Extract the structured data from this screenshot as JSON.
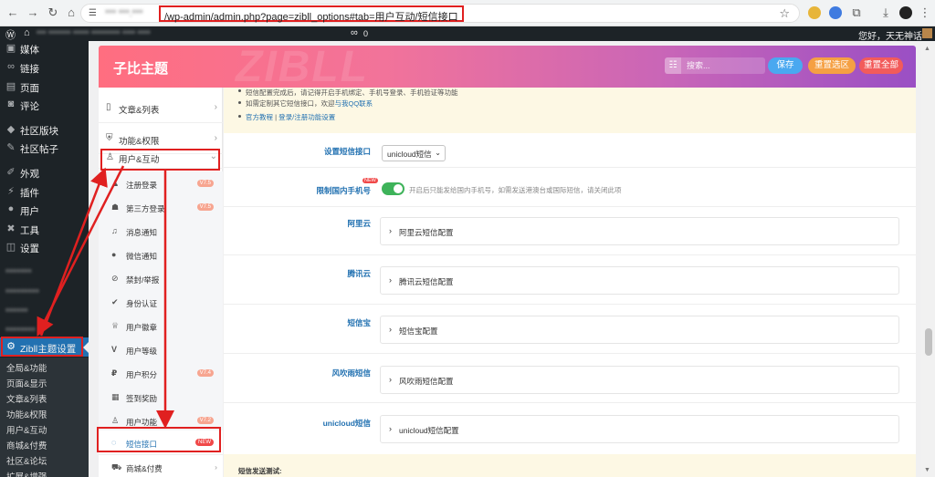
{
  "browser": {
    "url_site": "*** ***.***",
    "url_path": "/wp-admin/admin.php?page=zibll_options#tab=用户互动/短信接口",
    "icons": [
      "back-icon",
      "forward-icon",
      "reload-icon",
      "home-icon",
      "star-icon",
      "download-icon",
      "menu-icon"
    ]
  },
  "adminbar": {
    "blurred_items": "*** ******* ***** ********* **** ****",
    "comment_count": "0",
    "greeting": "您好，天无神话"
  },
  "wpmenu": {
    "items": [
      {
        "label": "媒体",
        "icon": "media-icon"
      },
      {
        "label": "链接",
        "icon": "link-icon"
      },
      {
        "label": "页面",
        "icon": "page-icon"
      },
      {
        "label": "评论",
        "icon": "comment-icon"
      },
      {
        "label": "社区版块",
        "icon": "forum-icon"
      },
      {
        "label": "社区帖子",
        "icon": "forum-post-icon"
      },
      {
        "label": "外观",
        "icon": "appearance-icon"
      },
      {
        "label": "插件",
        "icon": "plugin-icon"
      },
      {
        "label": "用户",
        "icon": "user-icon"
      },
      {
        "label": "工具",
        "icon": "tool-icon"
      },
      {
        "label": "设置",
        "icon": "settings-icon"
      }
    ],
    "blurred": [
      "*******",
      "*********",
      "******",
      "********"
    ],
    "active": "Zibll主题设置",
    "submenu": [
      "全局&功能",
      "页面&显示",
      "文章&列表",
      "功能&权限",
      "用户&互动",
      "商城&付费",
      "社区&论坛",
      "扩展&增强"
    ]
  },
  "header": {
    "title": "子比主题",
    "watermark": "ZIBLL",
    "search_placeholder": "搜索...",
    "save": "保存",
    "reset_section": "重置选区",
    "reset_all": "重置全部"
  },
  "optnav": {
    "groups": [
      {
        "label": "文章&列表",
        "icon": "book-icon"
      },
      {
        "label": "功能&权限",
        "icon": "shield-icon"
      },
      {
        "label": "用户&互动",
        "icon": "user-icon"
      }
    ],
    "subitems": [
      {
        "label": "注册登录",
        "icon": "user-plus-icon",
        "badge": "V7.5"
      },
      {
        "label": "第三方登录",
        "icon": "users-icon",
        "badge": "V7.5"
      },
      {
        "label": "消息通知",
        "icon": "bell-icon",
        "badge": ""
      },
      {
        "label": "微信通知",
        "icon": "wechat-icon",
        "badge": ""
      },
      {
        "label": "禁封/举报",
        "icon": "ban-icon",
        "badge": ""
      },
      {
        "label": "身份认证",
        "icon": "check-circle-icon",
        "badge": ""
      },
      {
        "label": "用户徽章",
        "icon": "trophy-icon",
        "badge": ""
      },
      {
        "label": "用户等级",
        "icon": "vip-icon",
        "badge": ""
      },
      {
        "label": "用户积分",
        "icon": "points-icon",
        "badge": "V7.4"
      },
      {
        "label": "签到奖励",
        "icon": "calendar-icon",
        "badge": ""
      },
      {
        "label": "用户功能",
        "icon": "user-icon",
        "badge": "V7.2"
      },
      {
        "label": "短信接口",
        "icon": "sms-icon",
        "badge": "NEW"
      }
    ],
    "shop": {
      "label": "商城&付费",
      "icon": "shop-icon"
    }
  },
  "notice": {
    "line1": "短信配置完成后，请记得开启手机绑定、手机号登录、手机验证等功能",
    "line2_prefix": "如需定制其它短信接口，欢迎",
    "line2_link": "与我QQ联系",
    "line3_link1": "官方教程",
    "line3_sep": "|",
    "line3_link2": "登录/注册功能设置"
  },
  "form": {
    "sms_api_label": "设置短信接口",
    "sms_api_value": "unicloud短信",
    "limit_label": "限制国内手机号",
    "limit_badge": "NEW",
    "limit_desc": "开启后只能发给国内手机号，如需发送港澳台或国际短信，请关闭此项",
    "limit_on": true,
    "providers": [
      {
        "label": "阿里云",
        "config": "阿里云短信配置"
      },
      {
        "label": "腾讯云",
        "config": "腾讯云短信配置"
      },
      {
        "label": "短信宝",
        "config": "短信宝配置"
      },
      {
        "label": "风吹雨短信",
        "config": "风吹雨短信配置"
      },
      {
        "label": "unicloud短信",
        "config": "unicloud短信配置"
      }
    ],
    "test_label": "短信发送测试:"
  },
  "colors": {
    "accent": "#2271b1",
    "annotation": "#e02020",
    "toggle_on": "#3eb35a",
    "save": "#4aa8f0",
    "reset_section": "#f5a043",
    "reset_all": "#f25b5b"
  }
}
